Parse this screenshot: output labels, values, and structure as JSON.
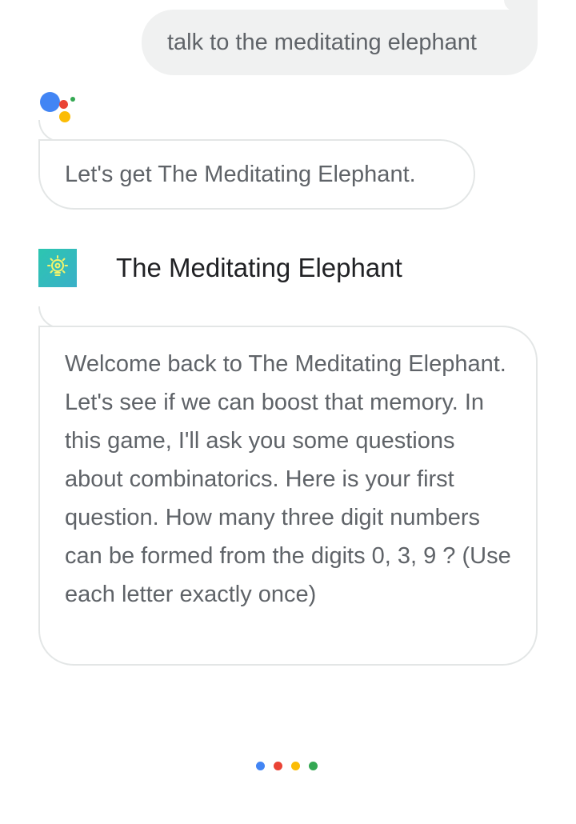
{
  "user_message": "talk to the meditating elephant",
  "assistant_reply": "Let's get The Meditating Elephant.",
  "action": {
    "name": "The Meditating Elephant",
    "icon": "lightbulb-icon"
  },
  "action_message": "Welcome back to The Meditating Elephant. Let's see if we can boost that memory. In this game, I'll ask you some questions about combinatorics. Here is your first question. How many three digit numbers can be formed from the digits 0, 3, 9 ? (Use each letter exactly once)",
  "colors": {
    "google_blue": "#4285f4",
    "google_red": "#ea4335",
    "google_yellow": "#fbbc05",
    "google_green": "#34a853",
    "action_icon_bg": "#2cc6b0"
  }
}
